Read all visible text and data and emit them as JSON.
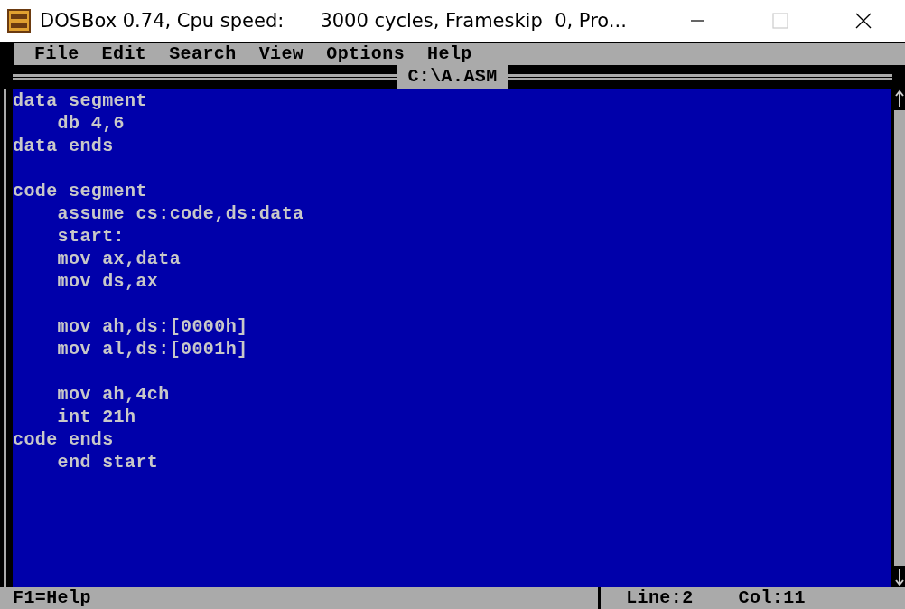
{
  "window": {
    "title": "DOSBox 0.74, Cpu speed:      3000 cycles, Frameskip  0, Pro..."
  },
  "menu": [
    "File",
    "Edit",
    "Search",
    "View",
    "Options",
    "Help"
  ],
  "editor": {
    "file_title": "C:\\A.ASM",
    "lines": [
      {
        "kind": "code",
        "text": "data segment"
      },
      {
        "kind": "code",
        "text": "    db 4,6"
      },
      {
        "kind": "code",
        "text": "data ends"
      },
      {
        "kind": "blank"
      },
      {
        "kind": "code",
        "text": "code segment"
      },
      {
        "kind": "code",
        "text": "    assume cs:code,ds:data"
      },
      {
        "kind": "code",
        "text": "    start:"
      },
      {
        "kind": "code",
        "text": "    mov ax,data"
      },
      {
        "kind": "code",
        "text": "    mov ds,ax"
      },
      {
        "kind": "blank"
      },
      {
        "kind": "code",
        "text": "    mov ah,ds:[0000h]"
      },
      {
        "kind": "code",
        "text": "    mov al,ds:[0001h]"
      },
      {
        "kind": "blank"
      },
      {
        "kind": "code",
        "text": "    mov ah,4ch"
      },
      {
        "kind": "code",
        "text": "    int 21h"
      },
      {
        "kind": "code",
        "text": "code ends"
      },
      {
        "kind": "code",
        "text": "    end start"
      }
    ]
  },
  "status_bar": {
    "help": "F1=Help",
    "line": "Line:2",
    "col": "Col:11"
  }
}
